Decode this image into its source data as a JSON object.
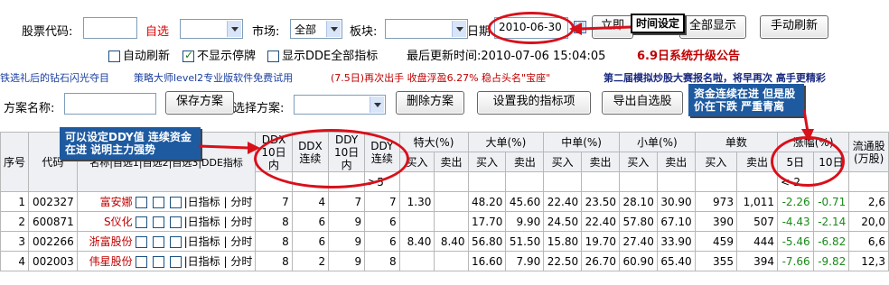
{
  "toolbar": {
    "stock_code_label": "股票代码:",
    "watchlist_label": "自选",
    "market_label": "市场:",
    "market_value": "全部",
    "sector_label": "板块:",
    "date_label": "日期",
    "date_value": "2010-06-30",
    "now_button": "立即",
    "show_all_button": "全部显示",
    "manual_refresh_button": "手动刷新",
    "auto_refresh_label": "自动刷新",
    "auto_refresh_checked": false,
    "hide_suspended_label": "不显示停牌",
    "hide_suspended_checked": true,
    "show_dde_label": "显示DDE全部指标",
    "show_dde_checked": false,
    "last_update": "最后更新时间:2010-07-06 15:04:05",
    "upgrade_notice": "6.9日系统升级公告"
  },
  "ticker": {
    "seg1": "铁选礼后的钻石闪光夺目",
    "seg2": "策略大师level2专业版软件免费试用",
    "seg3": "(7.5日)再次出手 收盘浮盈6.27% 稳占头名\"宝座\"",
    "seg4": "第二届模拟炒股大赛报名啦，将早再次 高手更精彩"
  },
  "scheme": {
    "name_label": "方案名称:",
    "save_button": "保存方案",
    "select_label": "选择方案:",
    "delete_button": "删除方案",
    "set_indicator_button": "设置我的指标项",
    "export_button": "导出自选股"
  },
  "annotations": {
    "time_setting": "时间设定",
    "ddy_note": "可以设定DDY值 连续资金在进 说明主力强势",
    "fund_note": "资金连续在进 但是股价在下跌 严重青离"
  },
  "table": {
    "headers": {
      "seq": "序号",
      "code": "代码",
      "name": "名称|自选1|自选2|自选3|DDE指标",
      "ddx10": "DDX 10日内",
      "ddx_cont": "DDX 连续",
      "ddy10": "DDY 10日内",
      "ddy_cont": "DDY 连续",
      "super_large": "特大(%)",
      "large": "大单(%)",
      "medium": "中单(%)",
      "small": "小单(%)",
      "count": "单数",
      "change": "涨幅(%)",
      "float": "流通股(万股)",
      "buy": "买入",
      "sell": "卖出",
      "d5": "5日",
      "d10": "10日"
    },
    "filters": {
      "ddy_cont": ">5",
      "change5": "<-2"
    },
    "link_day": "日指标",
    "link_time": "分时",
    "rows": [
      {
        "seq": "1",
        "code": "002327",
        "name": "富安娜",
        "ddx10": "7",
        "ddxc": "4",
        "ddy10": "7",
        "ddyc": "7",
        "tb": "1.30",
        "ts": "",
        "lb": "48.20",
        "ls": "45.60",
        "mb": "22.40",
        "ms": "23.50",
        "sb": "28.10",
        "ss": "30.90",
        "cb": "973",
        "cs": "1,011",
        "c5": "-2.26",
        "c10": "-0.71",
        "fl": "2,6"
      },
      {
        "seq": "2",
        "code": "600871",
        "name": "S仪化",
        "ddx10": "8",
        "ddxc": "6",
        "ddy10": "9",
        "ddyc": "6",
        "tb": "",
        "ts": "",
        "lb": "17.70",
        "ls": "9.90",
        "mb": "24.50",
        "ms": "22.40",
        "sb": "57.80",
        "ss": "67.10",
        "cb": "390",
        "cs": "507",
        "c5": "-4.43",
        "c10": "-2.14",
        "fl": "20,0"
      },
      {
        "seq": "3",
        "code": "002266",
        "name": "浙富股份",
        "ddx10": "8",
        "ddxc": "6",
        "ddy10": "9",
        "ddyc": "6",
        "tb": "8.40",
        "ts": "8.40",
        "lb": "56.80",
        "ls": "51.50",
        "mb": "15.80",
        "ms": "19.70",
        "sb": "27.40",
        "ss": "33.90",
        "cb": "459",
        "cs": "444",
        "c5": "-5.46",
        "c10": "-6.82",
        "fl": "6,6"
      },
      {
        "seq": "4",
        "code": "002003",
        "name": "伟星股份",
        "ddx10": "8",
        "ddxc": "2",
        "ddy10": "9",
        "ddyc": "8",
        "tb": "",
        "ts": "",
        "lb": "16.60",
        "ls": "7.90",
        "mb": "22.50",
        "ms": "26.70",
        "sb": "60.90",
        "ss": "65.40",
        "cb": "355",
        "cs": "394",
        "c5": "-7.66",
        "c10": "-9.82",
        "fl": "12,3"
      }
    ]
  }
}
